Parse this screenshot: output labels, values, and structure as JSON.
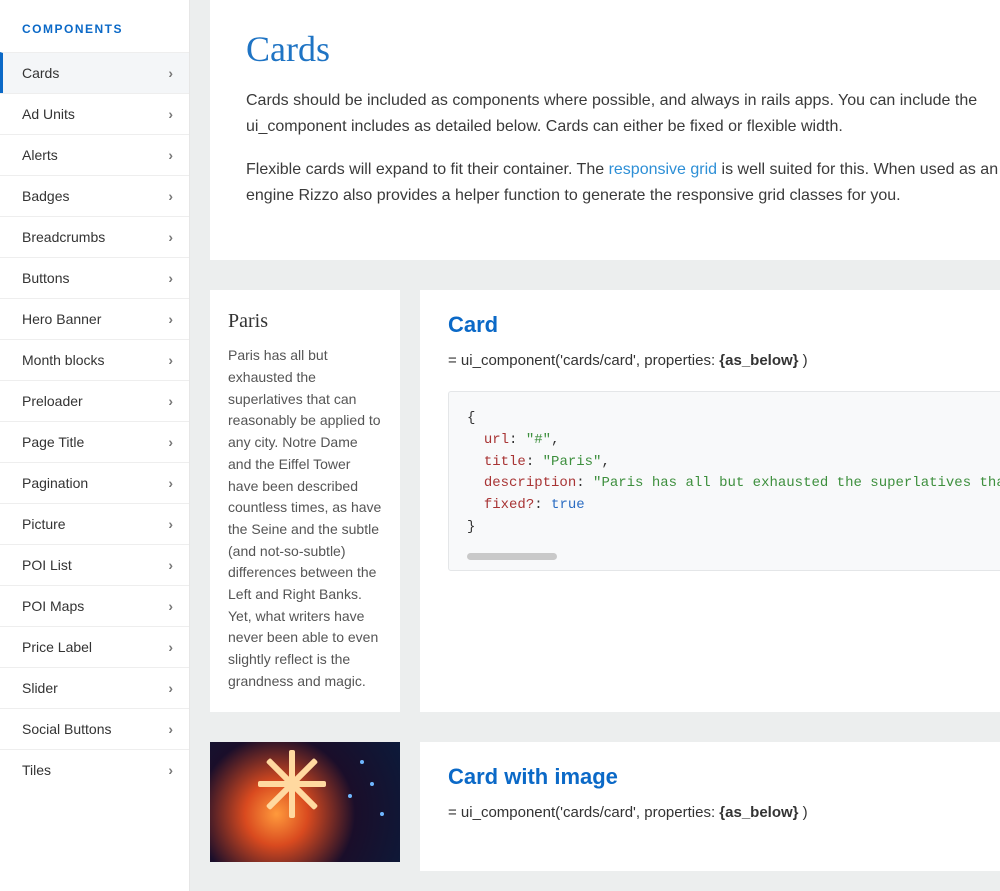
{
  "sidebar": {
    "title": "COMPONENTS",
    "items": [
      {
        "label": "Cards",
        "active": true
      },
      {
        "label": "Ad Units"
      },
      {
        "label": "Alerts"
      },
      {
        "label": "Badges"
      },
      {
        "label": "Breadcrumbs"
      },
      {
        "label": "Buttons"
      },
      {
        "label": "Hero Banner"
      },
      {
        "label": "Month blocks"
      },
      {
        "label": "Preloader"
      },
      {
        "label": "Page Title"
      },
      {
        "label": "Pagination"
      },
      {
        "label": "Picture"
      },
      {
        "label": "POI List"
      },
      {
        "label": "POI Maps"
      },
      {
        "label": "Price Label"
      },
      {
        "label": "Slider"
      },
      {
        "label": "Social Buttons"
      },
      {
        "label": "Tiles"
      }
    ]
  },
  "page": {
    "title": "Cards",
    "intro_p1": "Cards should be included as components where possible, and always in rails apps. You can include the ui_component includes as detailed below. Cards can either be fixed or flexible width.",
    "intro_p2_a": "Flexible cards will expand to fit their container. The ",
    "intro_p2_link": "responsive grid",
    "intro_p2_b": " is well suited for this. When used as an engine Rizzo also provides a helper function to generate the responsive grid classes for you."
  },
  "example1": {
    "card_title": "Paris",
    "card_desc": "Paris has all but exhausted the superlatives that can reasonably be applied to any city. Notre Dame and the Eiffel Tower have been described countless times, as have the Seine and the subtle (and not-so-subtle) differences between the Left and Right Banks. Yet, what writers have never been able to even slightly reflect is the grandness and magic.",
    "section_heading": "Card",
    "usage_prefix": "= ui_component('cards/card', properties: ",
    "usage_bold": "{as_below}",
    "usage_suffix": " )",
    "code": {
      "open": "{",
      "k1": "url",
      "v1": "\"#\"",
      "k2": "title",
      "v2": "\"Paris\"",
      "k3": "description",
      "v3": "\"Paris has all but exhausted the superlatives that ca",
      "k4": "fixed?",
      "v4": "true",
      "close": "}"
    }
  },
  "example2": {
    "section_heading": "Card with image",
    "usage_prefix": "= ui_component('cards/card', properties: ",
    "usage_bold": "{as_below}",
    "usage_suffix": " )"
  }
}
